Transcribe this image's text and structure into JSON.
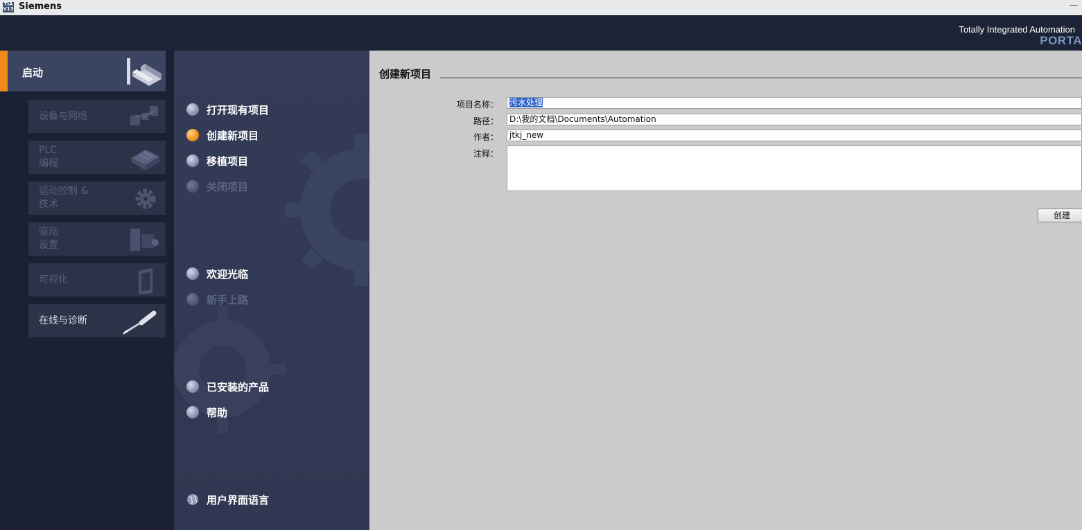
{
  "titlebar": {
    "logo": "TIA V13",
    "title": "Siemens",
    "window_button": "—"
  },
  "banner": {
    "line1": "Totally Integrated Automation",
    "line2": "PORTA"
  },
  "leftnav": {
    "start": {
      "label": "启动",
      "icon": "portal-start-icon"
    },
    "tiles": [
      {
        "label": "设备与网络",
        "icon": "devices-network-icon"
      },
      {
        "label": "PLC\n编程",
        "icon": "plc-programming-icon"
      },
      {
        "label": "运动控制 &\n技术",
        "icon": "motion-gear-icon"
      },
      {
        "label": "驱动\n设置",
        "icon": "drive-motor-icon"
      },
      {
        "label": "可视化",
        "icon": "hmi-panel-icon"
      },
      {
        "label": "在线与诊断",
        "icon": "diagnostics-screwdriver-icon"
      }
    ]
  },
  "menu": {
    "open_existing": "打开现有项目",
    "create_new": "创建新项目",
    "migrate": "移植项目",
    "close": "关闭项目",
    "welcome": "欢迎光临",
    "first_steps": "新手上路",
    "installed_products": "已安装的产品",
    "help": "帮助",
    "ui_language": "用户界面语言"
  },
  "form": {
    "heading": "创建新项目",
    "project_name_label": "项目名称：",
    "project_name_value": "污水处理",
    "path_label": "路径：",
    "path_value": "D:\\我的文档\\Documents\\Automation",
    "author_label": "作者：",
    "author_value": "jtkj_new",
    "comment_label": "注释：",
    "comment_value": "",
    "create_button": "创建"
  },
  "colors": {
    "accent": "#f08a1c",
    "content_bg": "#cbcbcb",
    "nav_bg": "#1b2132"
  }
}
